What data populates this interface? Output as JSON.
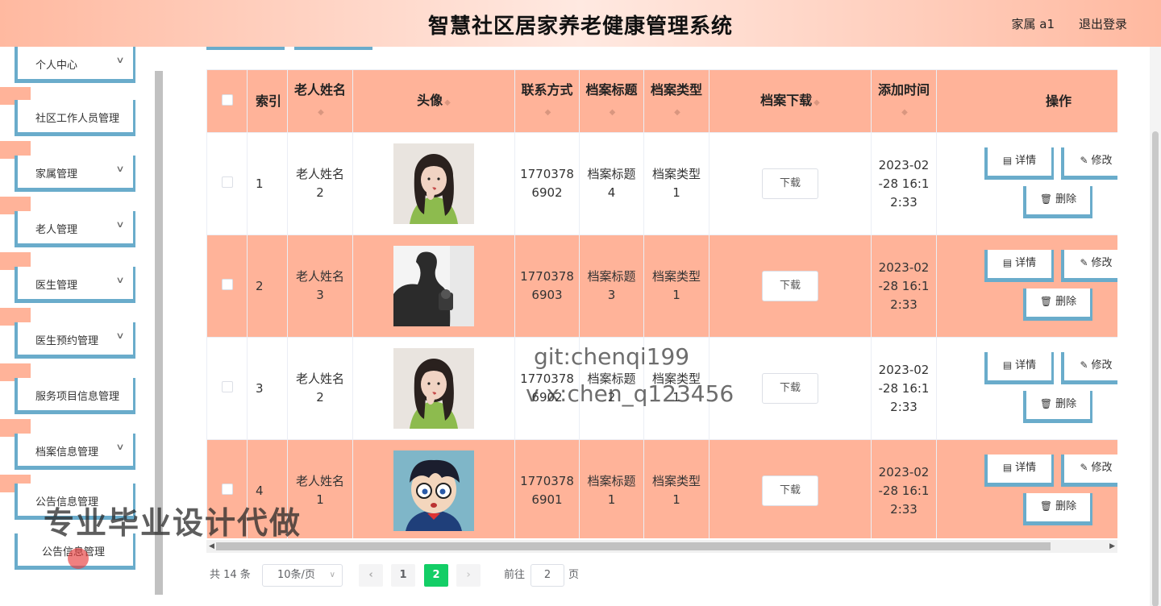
{
  "header": {
    "title": "智慧社区居家养老健康管理系统",
    "user": "家属 a1",
    "logout": "退出登录"
  },
  "sidebar": {
    "items": [
      {
        "label": "个人中心",
        "chevron": true
      },
      {
        "label": "社区工作人员管理",
        "chevron": false
      },
      {
        "label": "家属管理",
        "chevron": true
      },
      {
        "label": "老人管理",
        "chevron": true
      },
      {
        "label": "医生管理",
        "chevron": true
      },
      {
        "label": "医生预约管理",
        "chevron": true
      },
      {
        "label": "服务项目信息管理",
        "chevron": false
      },
      {
        "label": "档案信息管理",
        "chevron": true
      },
      {
        "label": "公告信息管理",
        "chevron": false
      },
      {
        "label": "公告信息管理",
        "chevron": false
      }
    ]
  },
  "table": {
    "headers": {
      "index": "索引",
      "name": "老人姓名",
      "avatar": "头像",
      "phone": "联系方式",
      "doc_title": "档案标题",
      "doc_type": "档案类型",
      "doc_download": "档案下载",
      "added": "添加时间",
      "ops": "操作"
    },
    "rows": [
      {
        "index": "1",
        "name": "老人姓名2",
        "avatar": "girl-photo",
        "phone": "17703786902",
        "doc_title": "档案标题4",
        "doc_type": "档案类型1",
        "download": "下载",
        "added": "2023-02-28 16:12:33"
      },
      {
        "index": "2",
        "name": "老人姓名3",
        "avatar": "man-silhouette-photo",
        "phone": "17703786903",
        "doc_title": "档案标题3",
        "doc_type": "档案类型1",
        "download": "下载",
        "added": "2023-02-28 16:12:33"
      },
      {
        "index": "3",
        "name": "老人姓名2",
        "avatar": "girl-photo",
        "phone": "17703786902",
        "doc_title": "档案标题2",
        "doc_type": "档案类型1",
        "download": "下载",
        "added": "2023-02-28 16:12:33"
      },
      {
        "index": "4",
        "name": "老人姓名1",
        "avatar": "cartoon-boy-photo",
        "phone": "17703786901",
        "doc_title": "档案标题1",
        "doc_type": "档案类型1",
        "download": "下载",
        "added": "2023-02-28 16:12:33"
      }
    ],
    "row_actions": {
      "detail": "详情",
      "edit": "修改",
      "delete": "删除"
    }
  },
  "pagination": {
    "total": "共 14 条",
    "page_size": "10条/页",
    "pages": [
      "1",
      "2"
    ],
    "current": "2",
    "goto_prefix": "前往",
    "goto_value": "2",
    "goto_suffix": "页"
  },
  "watermarks": {
    "git": "git:chenqi199",
    "wx": "v x:chen_q123456",
    "promo": "专业毕业设计代做"
  },
  "colors": {
    "accent": "#ffb399",
    "border_blue": "#6aaccb",
    "page_active": "#13ce66"
  }
}
